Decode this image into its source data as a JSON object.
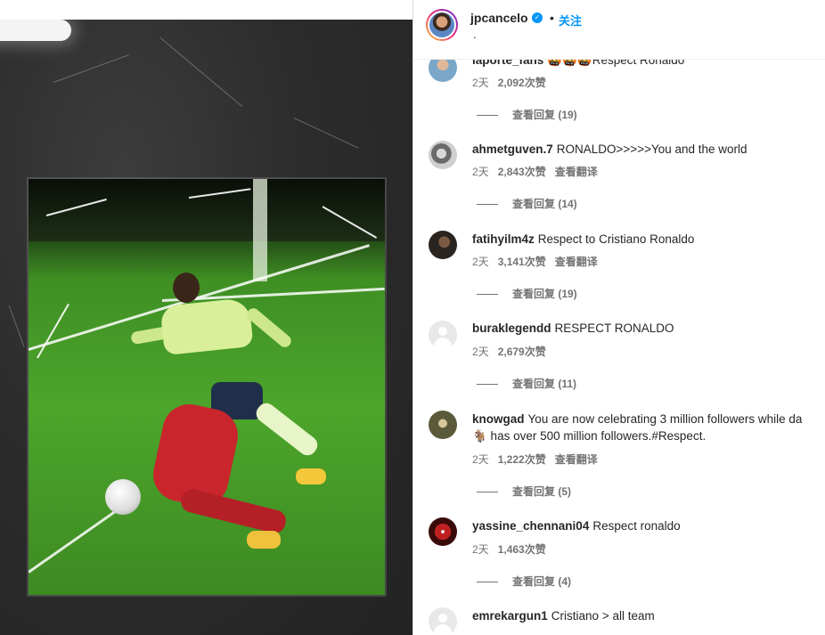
{
  "post_header": {
    "username": "jpcancelo",
    "follow_label": "关注",
    "separator": "•",
    "subtitle": "."
  },
  "comments": [
    {
      "username": "laporte_fans",
      "text": "🤬🤬🤬Respect Ronaldo",
      "time": "2天",
      "likes": "2,092次赞",
      "translate": "",
      "replies": "查看回复 (19)"
    },
    {
      "username": "ahmetguven.7",
      "text": "RONALDO>>>>>You and the world",
      "time": "2天",
      "likes": "2,843次赞",
      "translate": "查看翻译",
      "replies": "查看回复 (14)"
    },
    {
      "username": "fatihyilm4z",
      "text": "Respect to Cristiano Ronaldo",
      "time": "2天",
      "likes": "3,141次赞",
      "translate": "查看翻译",
      "replies": "查看回复 (19)"
    },
    {
      "username": "buraklegendd",
      "text": "RESPECT RONALDO",
      "time": "2天",
      "likes": "2,679次赞",
      "translate": "",
      "replies": "查看回复 (11)"
    },
    {
      "username": "knowgad",
      "text": "You are now celebrating 3 million followers while da",
      "text_line2_prefix": "🐐 has over 500 million followers.",
      "hashtag": "#Respect",
      "text_line2_suffix": ".",
      "time": "2天",
      "likes": "1,222次赞",
      "translate": "查看翻译",
      "replies": "查看回复 (5)"
    },
    {
      "username": "yassine_chennani04",
      "text": "Respect ronaldo",
      "time": "2天",
      "likes": "1,463次赞",
      "translate": "",
      "replies": "查看回复 (4)"
    },
    {
      "username": "emrekargun1",
      "text": "Cristiano > all team",
      "time": "",
      "likes": "",
      "translate": "",
      "replies": ""
    }
  ],
  "icons": {
    "verified": "verified-badge-icon",
    "default_avatar": "default-avatar-icon"
  },
  "colors": {
    "link_blue": "#0095f6",
    "hashtag": "#00376b",
    "muted": "#737373",
    "media_bg": "#2b2b2b"
  }
}
